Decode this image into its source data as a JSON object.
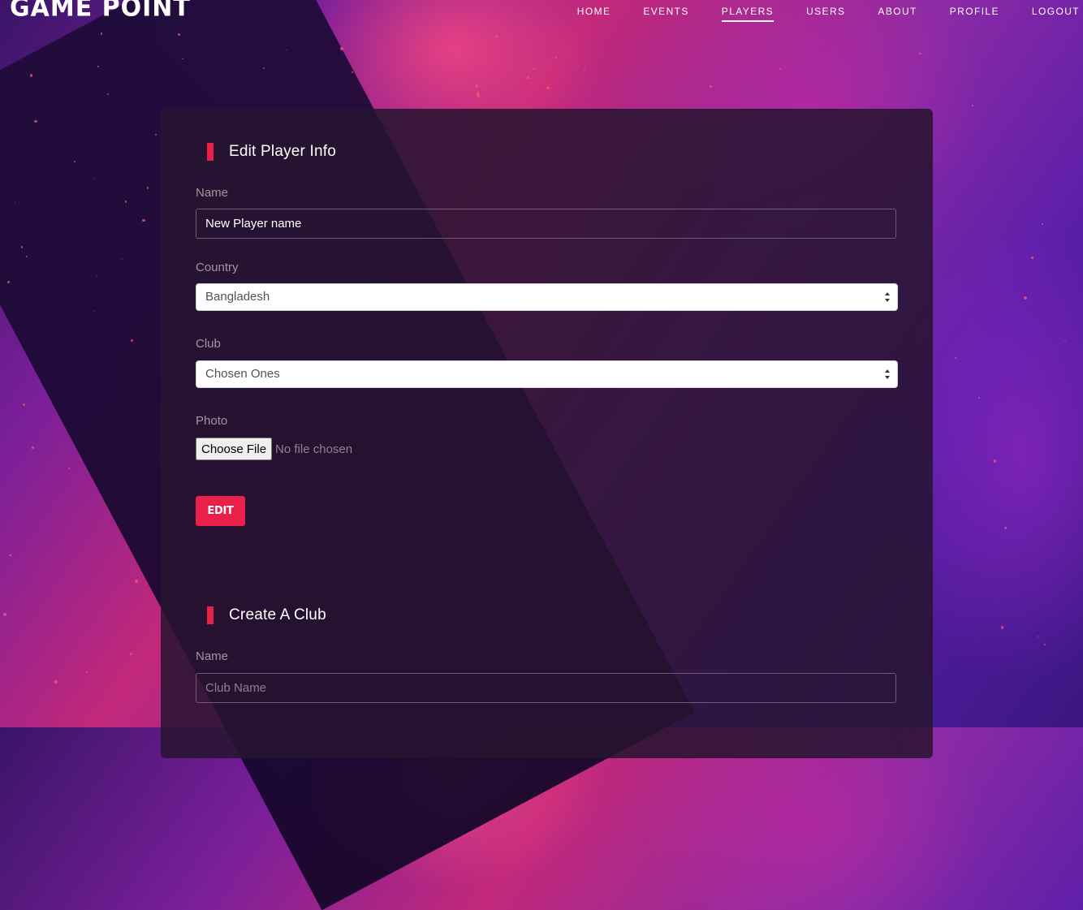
{
  "app": {
    "logo": "GAME POINT"
  },
  "nav": {
    "items": [
      {
        "label": "HOME",
        "active": false
      },
      {
        "label": "EVENTS",
        "active": false
      },
      {
        "label": "PLAYERS",
        "active": true
      },
      {
        "label": "USERS",
        "active": false
      },
      {
        "label": "ABOUT",
        "active": false
      },
      {
        "label": "PROFILE",
        "active": false
      },
      {
        "label": "LOGOUT",
        "active": false
      }
    ]
  },
  "edit_player": {
    "title": "Edit Player Info",
    "name_label": "Name",
    "name_value": "New Player name",
    "country_label": "Country",
    "country_value": "Bangladesh",
    "club_label": "Club",
    "club_value": "Chosen Ones",
    "photo_label": "Photo",
    "choose_file_label": "Choose File",
    "file_status": "No file chosen",
    "edit_label": "EDIT"
  },
  "create_club": {
    "title": "Create A Club",
    "name_label": "Name",
    "name_placeholder": "Club Name"
  },
  "colors": {
    "accent": "#e8204a",
    "panel": "#261430",
    "text": "#ffffff",
    "label": "#a3959d"
  },
  "icons": {
    "select_arrows": "up-down-caret-icon",
    "title_marker": "vertical-bar-icon"
  }
}
